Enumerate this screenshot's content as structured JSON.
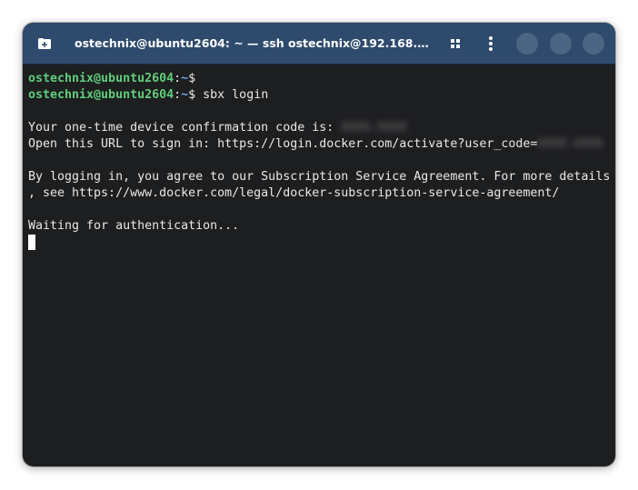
{
  "window": {
    "title": "ostechnix@ubuntu2604: ~ — ssh ostechnix@192.168.0....",
    "colors": {
      "titlebar": "#2e4a6c",
      "background": "#1d1e20",
      "prompt_user": "#5fcf7a",
      "prompt_path": "#6ea8f0",
      "text": "#e8e8e8"
    }
  },
  "icons": {
    "new_tab": "new-tab-icon",
    "tabs_overview": "tabs-overview-icon",
    "menu": "kebab-menu-icon"
  },
  "terminal": {
    "prompt_user": "ostechnix@ubuntu2604",
    "prompt_sep": ":",
    "prompt_path": "~",
    "prompt_symbol": "$ ",
    "command": "sbx login",
    "code_line_prefix": "Your one-time device confirmation code is: ",
    "code_redacted": "XXXX-XXXX",
    "url_line_prefix": "Open this URL to sign in: https://login.docker.com/activate?user_code=",
    "url_code_redacted": "XXXX-XXXX",
    "agreement_line1": "By logging in, you agree to our Subscription Service Agreement. For more details",
    "agreement_line2": ", see https://www.docker.com/legal/docker-subscription-service-agreement/",
    "waiting": "Waiting for authentication..."
  }
}
